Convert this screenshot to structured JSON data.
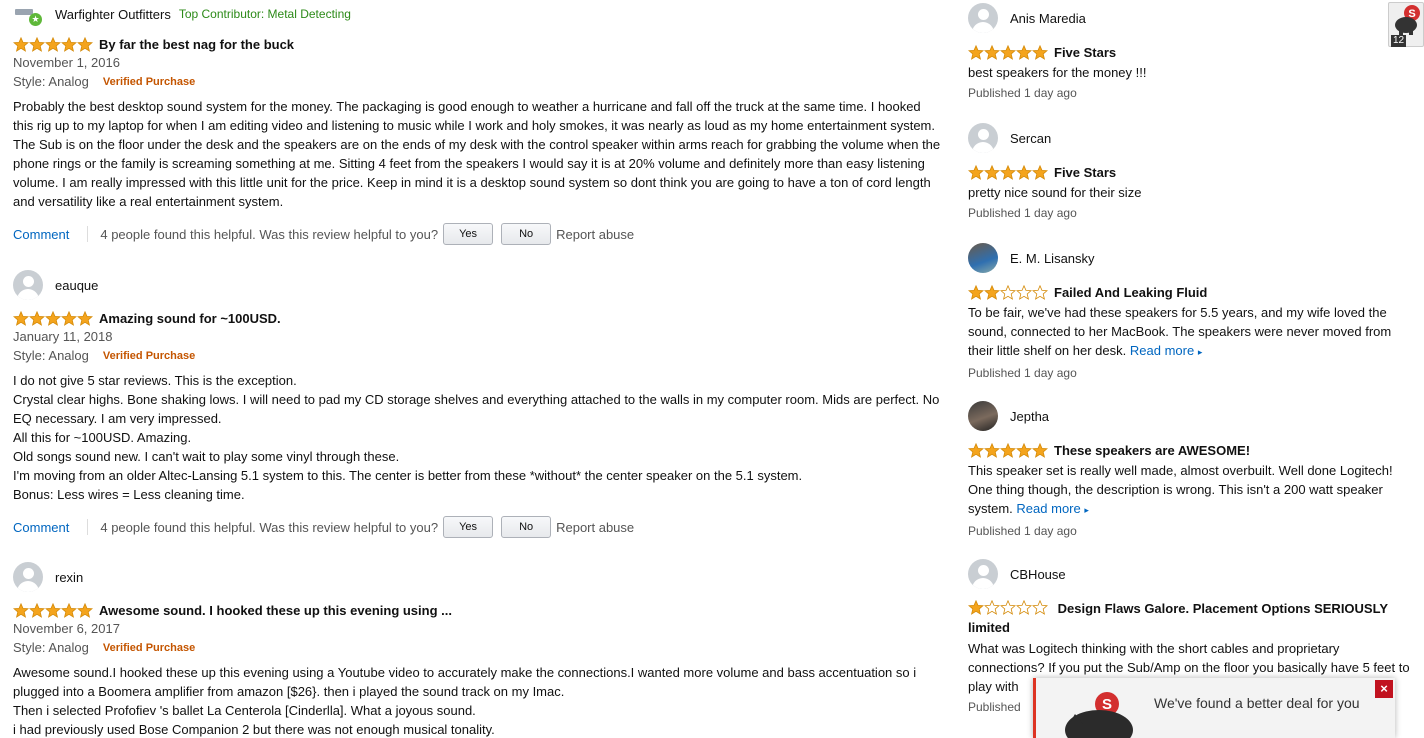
{
  "left_reviews": [
    {
      "author": "Warfighter Outfitters",
      "badge": "Top Contributor: Metal Detecting",
      "rating": 5,
      "title": "By far the best nag for the buck",
      "date": "November 1, 2016",
      "style": "Style: Analog",
      "verified": "Verified Purchase",
      "body": [
        "Probably the best desktop sound system for the money. The packaging is good enough to weather a hurricane and fall off the truck at the same time. I hooked this rig up to my laptop for when I am editing video and listening to music while I work and holy smokes, it was nearly as loud as my home entertainment system. The Sub is on the floor under the desk and the speakers are on the ends of my desk with the control speaker within arms reach for grabbing the volume when the phone rings or the family is screaming something at me. Sitting 4 feet from the speakers I would say it is at 20% volume and definitely more than easy listening volume. I am really impressed with this little unit for the price. Keep in mind it is a desktop sound system so dont think you are going to have a ton of cord length and versatility like a real entertainment system."
      ],
      "comment": "Comment",
      "helpful": "4 people found this helpful. Was this review helpful to you?",
      "yes": "Yes",
      "no": "No",
      "report": "Report abuse"
    },
    {
      "author": "eauque",
      "rating": 5,
      "title": "Amazing sound for ~100USD.",
      "date": "January 11, 2018",
      "style": "Style: Analog",
      "verified": "Verified Purchase",
      "body": [
        "I do not give 5 star reviews. This is the exception.",
        "Crystal clear highs. Bone shaking lows. I will need to pad my CD storage shelves and everything attached to the walls in my computer room. Mids are perfect. No EQ necessary. I am very impressed.",
        "All this for ~100USD. Amazing.",
        "Old songs sound new. I can't wait to play some vinyl through these.",
        "I'm moving from an older Altec-Lansing 5.1 system to this. The center is better from these *without* the center speaker on the 5.1 system.",
        "Bonus: Less wires = Less cleaning time."
      ],
      "comment": "Comment",
      "helpful": "4 people found this helpful. Was this review helpful to you?",
      "yes": "Yes",
      "no": "No",
      "report": "Report abuse"
    },
    {
      "author": "rexin",
      "rating": 5,
      "title": "Awesome sound. I hooked these up this evening using ...",
      "date": "November 6, 2017",
      "style": "Style: Analog",
      "verified": "Verified Purchase",
      "body": [
        "Awesome sound.I hooked these up this evening using a Youtube video to accurately make the connections.I wanted more volume and bass accentuation so i plugged into a Boomera amplifier from amazon [$26}. then i played the sound track on my Imac.",
        "Then i selected Profofiev 's ballet La Centerola [Cinderlla]. What a joyous sound.",
        "i had previously used Bose Companion 2 but there was not enough musical tonality."
      ]
    }
  ],
  "side_reviews": [
    {
      "author": "Anis Maredia",
      "rating": 5,
      "title": "Five Stars",
      "body": "best speakers for the money !!!",
      "published": "Published 1 day ago"
    },
    {
      "author": "Sercan",
      "rating": 5,
      "title": "Five Stars",
      "body": "pretty nice sound for their size",
      "published": "Published 1 day ago"
    },
    {
      "author": "E. M. Lisansky",
      "rating": 2,
      "title": "Failed And Leaking Fluid",
      "body": "To be fair, we've had these speakers for 5.5 years, and my wife loved the sound, connected to her MacBook. The speakers were never moved from their little shelf on her desk.",
      "read_more": "Read more",
      "published": "Published 1 day ago"
    },
    {
      "author": "Jeptha",
      "rating": 5,
      "title": "These speakers are AWESOME!",
      "body": "This speaker set is really well made, almost overbuilt. Well done Logitech! One thing though, the description is wrong. This isn't a 200 watt speaker system.",
      "read_more": "Read more",
      "published": "Published 1 day ago"
    },
    {
      "author": "CBHouse",
      "rating": 1,
      "title": "Design Flaws Galore. Placement Options SERIOUSLY limited",
      "body": "What was Logitech thinking with the short cables and proprietary connections? If you put the Sub/Amp on the floor you basically have 5 feet to play with",
      "published": "Published"
    }
  ],
  "extension": {
    "badge": "12"
  },
  "popup": {
    "message": "We've found a better deal for you",
    "close": "×"
  },
  "colors": {
    "star": "#f4a41d",
    "link": "#0066c0",
    "verified": "#c45500",
    "contributor": "#2c8a18"
  }
}
